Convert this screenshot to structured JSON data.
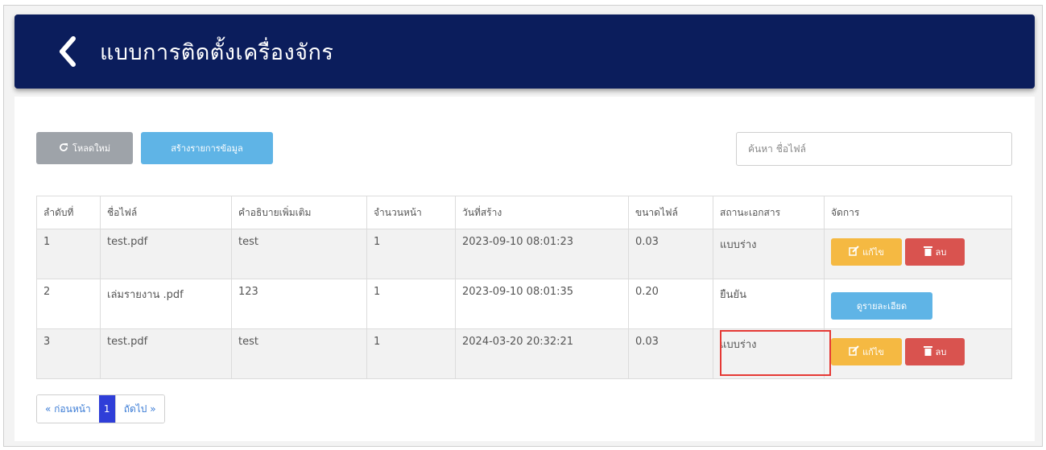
{
  "header": {
    "title": "แบบการติดตั้งเครื่องจักร",
    "back_icon": "chevron-left-icon"
  },
  "toolbar": {
    "reload_label": "โหลดใหม่",
    "reload_icon": "refresh-icon",
    "create_label": "สร้างรายการข้อมูล"
  },
  "search": {
    "placeholder": "ค้นหา ชื่อไฟล์",
    "value": ""
  },
  "table": {
    "headers": [
      "ลำดับที่",
      "ชื่อไฟล์",
      "คำอธิบายเพิ่มเติม",
      "จำนวนหน้า",
      "วันที่สร้าง",
      "ขนาดไฟล์",
      "สถานะเอกสาร",
      "จัดการ"
    ],
    "rows": [
      {
        "no": "1",
        "file": "test.pdf",
        "desc": "test",
        "pages": "1",
        "created": "2023-09-10 08:01:23",
        "size": "0.03",
        "status": "แบบร่าง",
        "actions": "edit-delete"
      },
      {
        "no": "2",
        "file": "เล่มรายงาน .pdf",
        "desc": "123",
        "pages": "1",
        "created": "2023-09-10 08:01:35",
        "size": "0.20",
        "status": "ยืนยัน",
        "actions": "detail"
      },
      {
        "no": "3",
        "file": "test.pdf",
        "desc": "test",
        "pages": "1",
        "created": "2024-03-20 20:32:21",
        "size": "0.03",
        "status": "แบบร่าง",
        "actions": "edit-delete"
      }
    ],
    "edit_label": "แก้ไข",
    "delete_label": "ลบ",
    "detail_label": "ดูรายละเอียด"
  },
  "pagination": {
    "prev_label": "« ก่อนหน้า",
    "current_page": "1",
    "next_label": "ถัดไป »"
  },
  "colors": {
    "header_bg": "#0b1d5c",
    "edit": "#f5b942",
    "delete": "#d9534f",
    "info": "#5fb4e6",
    "reload": "#9ea3a9",
    "highlight": "#e53935",
    "page_active": "#2f3ed8"
  }
}
